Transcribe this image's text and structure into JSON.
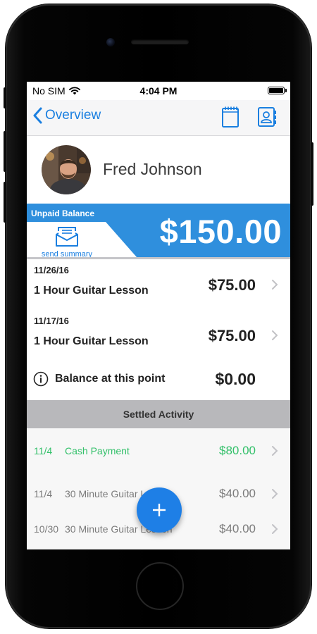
{
  "status_bar": {
    "carrier": "No SIM",
    "time": "4:04 PM"
  },
  "nav": {
    "back_label": "Overview",
    "notes_icon": "notebook-icon",
    "contact_icon": "contact-card-icon"
  },
  "profile": {
    "name": "Fred Johnson"
  },
  "balance": {
    "label": "Unpaid Balance",
    "amount": "$150.00",
    "send_summary_label": "send summary"
  },
  "unpaid_items": [
    {
      "date": "11/26/16",
      "description": "1 Hour Guitar Lesson",
      "amount": "$75.00"
    },
    {
      "date": "11/17/16",
      "description": "1 Hour Guitar Lesson",
      "amount": "$75.00"
    }
  ],
  "balance_point": {
    "label": "Balance at this point",
    "amount": "$0.00"
  },
  "settled": {
    "header": "Settled Activity",
    "items": [
      {
        "date": "11/4",
        "description": "Cash Payment",
        "amount": "$80.00"
      },
      {
        "date": "11/4",
        "description": "30 Minute Guitar Lesson",
        "amount": "$40.00"
      },
      {
        "date": "10/30",
        "description": "30 Minute Guitar Lesson",
        "amount": "$40.00"
      }
    ]
  },
  "colors": {
    "accent": "#1a7fe0",
    "band": "#2f8fdd",
    "payment_green": "#33c06a",
    "fab": "#1e7fe6"
  }
}
